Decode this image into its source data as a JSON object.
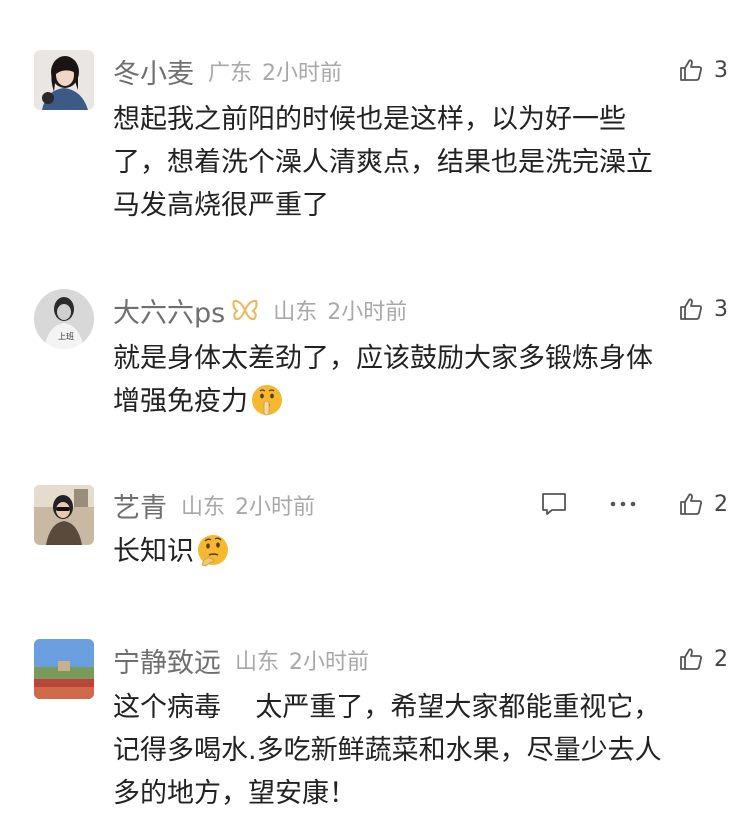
{
  "comments": [
    {
      "username": "冬小麦",
      "location": "广东",
      "time": "2小时前",
      "text": "想起我之前阳的时候也是这样，以为好一些\n了，想着洗个澡人清爽点，结果也是洗完澡立\n马发高烧很严重了",
      "likes": "3"
    },
    {
      "username": "大六六ps",
      "badge": "butterfly-badge-icon",
      "location": "山东",
      "time": "2小时前",
      "text": "就是身体太差劲了，应该鼓励大家多锻炼身体\n增强免疫力",
      "emoji": "shushing-face-emoji",
      "likes": "3",
      "avatar_text": "上班"
    },
    {
      "username": "艺青",
      "location": "山东",
      "time": "2小时前",
      "text": "长知识",
      "emoji": "thinking-face-emoji",
      "likes": "2"
    },
    {
      "username": "宁静致远",
      "location": "山东",
      "time": "2小时前",
      "text": "这个病毒    太严重了，希望大家都能重视它，\n记得多喝水.多吃新鲜蔬菜和水果，尽量少去人\n多的地方，望安康！",
      "likes": "2"
    }
  ],
  "colors": {
    "username": "#6f6f6f",
    "meta": "#a8a8a8",
    "text": "#222222",
    "icon": "#555555",
    "badge": "#f0b45a",
    "emoji": "#f5b82e"
  }
}
